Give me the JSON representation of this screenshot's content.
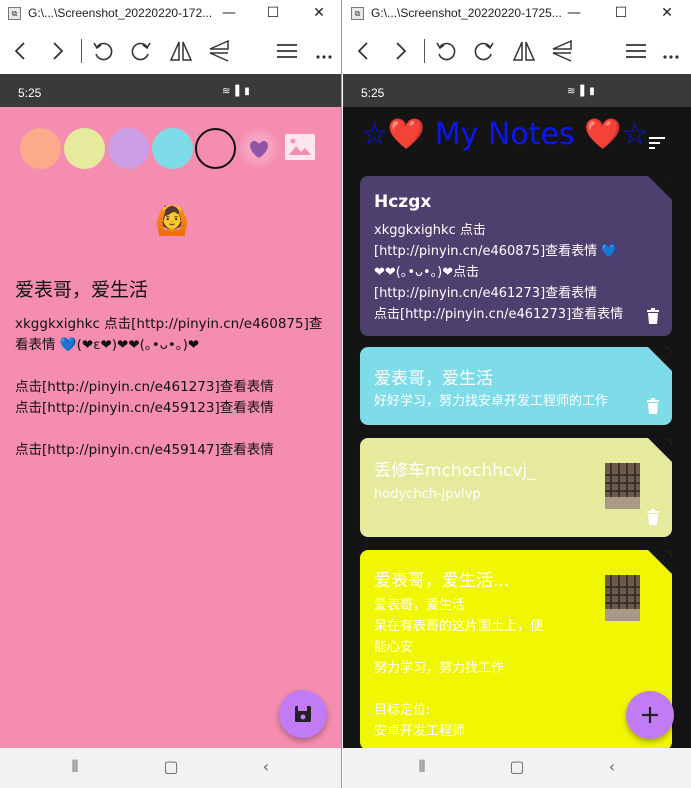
{
  "left_window": {
    "title": "G:\\...\\Screenshot_20220220-172...",
    "controls": {
      "minimize": "—",
      "maximize": "☐",
      "close": "✕"
    },
    "status_time": "5:25",
    "editor": {
      "colors": [
        "#fcaa8c",
        "#e6ea9c",
        "#cc9ee6",
        "#7edce9",
        "#f48db0"
      ],
      "background": "#f48db0",
      "title": "爱表哥，爱生活",
      "body": [
        "xkggkxighkc 点击[http://pinyin.cn/e460875]查看表情 💙(❤ε❤)❤❤(｡•ᴗ•｡)❤",
        "点击[http://pinyin.cn/e461273]查看表情\n点击[http://pinyin.cn/e459123]查看表情",
        "点击[http://pinyin.cn/e459147]查看表情"
      ],
      "save_icon": "save-icon"
    }
  },
  "right_window": {
    "title": "G:\\...\\Screenshot_20220220-1725...",
    "controls": {
      "minimize": "—",
      "maximize": "☐",
      "close": "✕"
    },
    "status_time": "5:25",
    "header": "☆❤️ My Notes ❤️☆",
    "notes": [
      {
        "title": "Hczgx",
        "body": "xkggkxighkc 点击\n[http://pinyin.cn/e460875]查看表情 💙\n❤❤(｡•ᴗ•｡)❤点击\n[http://pinyin.cn/e461273]查看表情\n点击[http://pinyin.cn/e461273]查看表情",
        "color": "#4d3f6e"
      },
      {
        "title": "爱表哥，爱生活",
        "body": "好好学习，努力找安卓开发工程师的工作",
        "color": "#7edce9"
      },
      {
        "title": "丢修车mchochhcvj_",
        "body": "hodychch-jpvlvp",
        "color": "#e6ea9c"
      },
      {
        "title": "爱表哥，爱生活...",
        "body": "爱表哥，爱生活\n呆在有表哥的这片国土上，便\n能心安\n努力学习，努力找工作\n\n目标定位:\n安卓开发工程师",
        "color": "#f1f700"
      }
    ],
    "add_icon": "plus-icon"
  }
}
